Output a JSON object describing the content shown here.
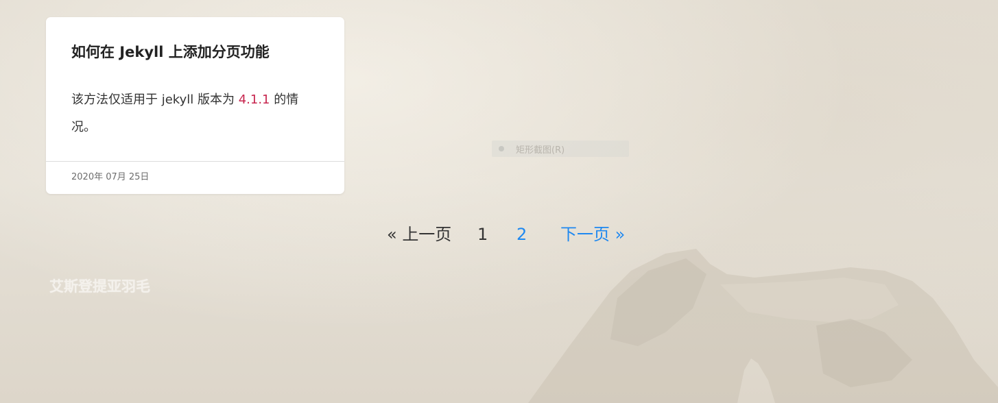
{
  "post": {
    "title": "如何在 Jekyll 上添加分页功能",
    "excerpt_before": "该方法仅适用于 jekyll 版本为 ",
    "excerpt_version": "4.1.1",
    "excerpt_after": " 的情况。",
    "date": "2020年 07月 25日"
  },
  "overlay": {
    "label": "矩形截图(R)"
  },
  "pagination": {
    "prev_label": "« 上一页",
    "pages": [
      "1",
      "2"
    ],
    "current_page": "1",
    "next_label": "下一页 »"
  },
  "footer": {
    "site_name": "艾斯登提亚羽毛"
  },
  "colors": {
    "link": "#1e88f0",
    "version_highlight": "#c7254e",
    "card_background": "#ffffff"
  }
}
